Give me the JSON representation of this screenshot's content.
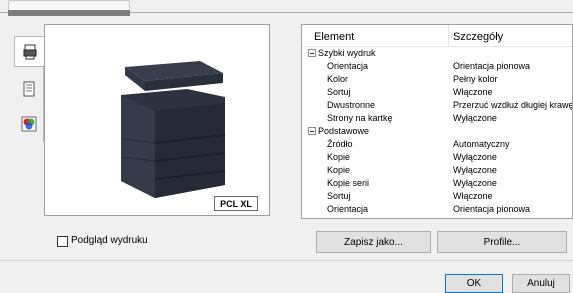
{
  "preview": {
    "badge": "PCL XL"
  },
  "tabs": [
    {
      "name": "printer-settings-icon",
      "active": true
    },
    {
      "name": "document-icon",
      "active": false
    },
    {
      "name": "color-icon",
      "active": false
    }
  ],
  "details": {
    "header": {
      "element": "Element",
      "details": "Szczegóły"
    },
    "rows": [
      {
        "element": "Szybki wydruk",
        "value": "",
        "group": true
      },
      {
        "element": "Orientacja",
        "value": "Orientacja pionowa",
        "group": false
      },
      {
        "element": "Kolor",
        "value": "Pełny kolor",
        "group": false
      },
      {
        "element": "Sortuj",
        "value": "Włączone",
        "group": false
      },
      {
        "element": "Dwustronne",
        "value": "Przerzuć wzdłuż długiej krawędzi",
        "group": false
      },
      {
        "element": "Strony na kartkę",
        "value": "Wyłączone",
        "group": false
      },
      {
        "element": "Podstawowe",
        "value": "",
        "group": true
      },
      {
        "element": "Źródło",
        "value": "Automatyczny",
        "group": false
      },
      {
        "element": "Kopie",
        "value": "Wyłączone",
        "group": false
      },
      {
        "element": "Kopie",
        "value": "Wyłączone",
        "group": false
      },
      {
        "element": "Kopie serii",
        "value": "Wyłączone",
        "group": false
      },
      {
        "element": "Sortuj",
        "value": "Włączone",
        "group": false
      },
      {
        "element": "Orientacja",
        "value": "Orientacja pionowa",
        "group": false
      }
    ]
  },
  "checkbox": {
    "label": "Podgląd wydruku",
    "checked": false
  },
  "buttons": {
    "save": "Zapisz jako...",
    "profile": "Profile...",
    "ok": "OK",
    "cancel": "Anuluj"
  }
}
